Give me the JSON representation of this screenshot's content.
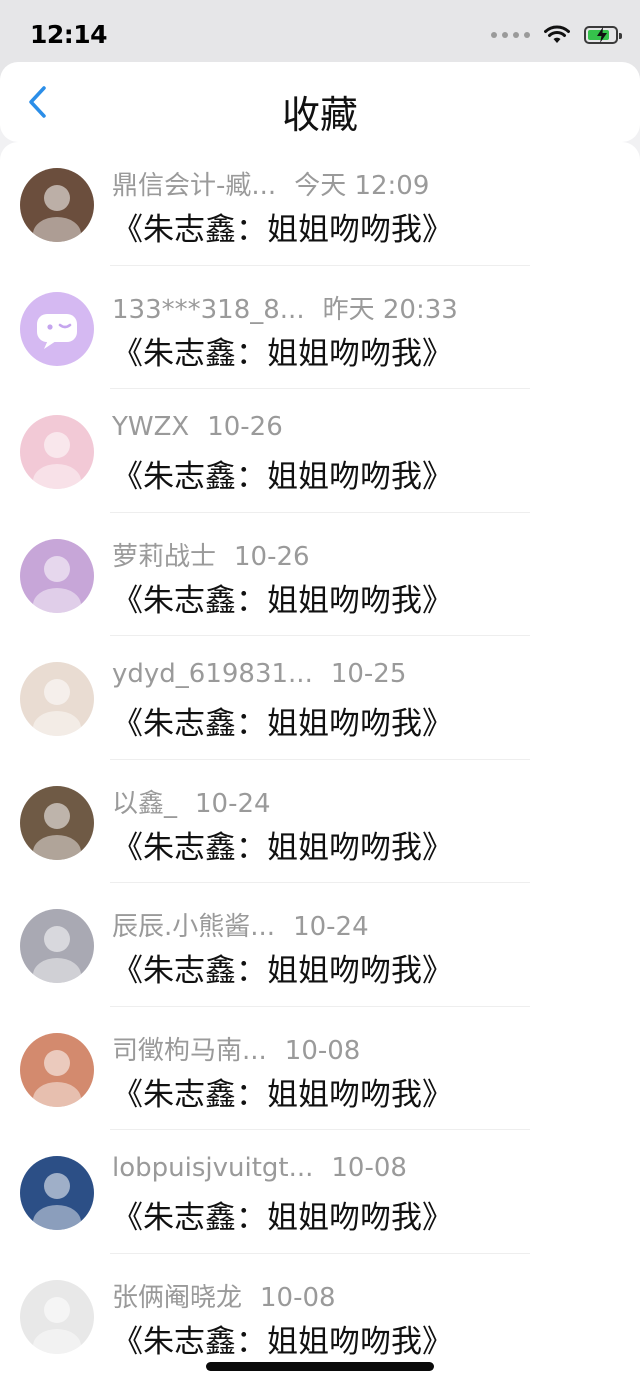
{
  "status_bar": {
    "time": "12:14",
    "battery_level": 0.8,
    "battery_color": "#35c24b"
  },
  "nav": {
    "title": "收藏",
    "back_icon": "chevron-left-icon",
    "accent": "#2b8ee8"
  },
  "favorites": [
    {
      "user": "鼎信会计-臧...",
      "time": "今天 12:09",
      "content": "《朱志鑫：姐姐吻吻我》",
      "avatar_icon": "user-avatar-icon",
      "avatar_color": "#6b4e3d"
    },
    {
      "user": "133***318_8...",
      "time": "昨天 20:33",
      "content": "《朱志鑫：姐姐吻吻我》",
      "avatar_icon": "chat-bubble-icon",
      "avatar_color": "#d5b9f2"
    },
    {
      "user": "YWZX",
      "time": "10-26",
      "content": "《朱志鑫：姐姐吻吻我》",
      "avatar_icon": "user-avatar-icon",
      "avatar_color": "#f2c9d6"
    },
    {
      "user": "萝莉战士",
      "time": "10-26",
      "content": "《朱志鑫：姐姐吻吻我》",
      "avatar_icon": "user-avatar-icon",
      "avatar_color": "#c7a6d8"
    },
    {
      "user": "ydyd_619831...",
      "time": "10-25",
      "content": "《朱志鑫：姐姐吻吻我》",
      "avatar_icon": "user-avatar-icon",
      "avatar_color": "#e9dcd2"
    },
    {
      "user": "以鑫_",
      "time": "10-24",
      "content": "《朱志鑫：姐姐吻吻我》",
      "avatar_icon": "user-avatar-icon",
      "avatar_color": "#6f5a45"
    },
    {
      "user": "辰辰.小熊酱...",
      "time": "10-24",
      "content": "《朱志鑫：姐姐吻吻我》",
      "avatar_icon": "user-avatar-icon",
      "avatar_color": "#a9a9b3"
    },
    {
      "user": "司徵枸马南...",
      "time": "10-08",
      "content": "《朱志鑫：姐姐吻吻我》",
      "avatar_icon": "user-avatar-icon",
      "avatar_color": "#d38a6e"
    },
    {
      "user": "lobpuisjvuitgt...",
      "time": "10-08",
      "content": "《朱志鑫：姐姐吻吻我》",
      "avatar_icon": "user-avatar-icon",
      "avatar_color": "#2c4f86"
    },
    {
      "user": "张俩阉晓龙",
      "time": "10-08",
      "content": "《朱志鑫：姐姐吻吻我》",
      "avatar_icon": "user-avatar-icon",
      "avatar_color": "#e8e8e8"
    }
  ]
}
